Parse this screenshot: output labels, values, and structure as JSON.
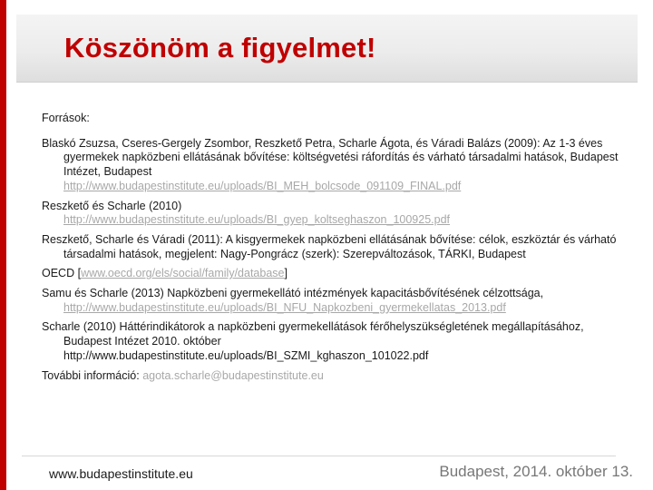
{
  "title": "Köszönöm a figyelmet!",
  "sources_heading": "Források:",
  "references": [
    {
      "text": "Blaskó Zsuzsa, Cseres-Gergely Zsombor, Reszkető Petra, Scharle Ágota, és Váradi Balázs (2009): Az 1-3 éves gyermekek napközbeni ellátásának bővítése: költségvetési ráfordítás és várható társadalmi hatások, Budapest Intézet, Budapest",
      "url": "http://www.budapestinstitute.eu/uploads/BI_MEH_bolcsode_091109_FINAL.pdf"
    },
    {
      "text": "Reszkető és Scharle (2010)",
      "url": "http://www.budapestinstitute.eu/uploads/BI_gyep_koltseghaszon_100925.pdf"
    },
    {
      "text": "Reszkető, Scharle és Váradi (2011): A kisgyermekek napközbeni ellátásának bővítése: célok, eszköztár és várható társadalmi hatások, megjelent: Nagy-Pongrácz (szerk): Szerepváltozások, TÁRKI, Budapest"
    }
  ],
  "oecd": {
    "prefix": "OECD [",
    "url": "www.oecd.org/els/social/family/database",
    "suffix": "]"
  },
  "references_2": [
    {
      "text": "Samu és Scharle (2013) Napközbeni gyermekellátó intézmények kapacitásbővítésének célzottsága,",
      "url": "http://www.budapestinstitute.eu/uploads/BI_NFU_Napkozbeni_gyermekellatas_2013.pdf"
    },
    {
      "text": "Scharle (2010) Háttérindikátorok a napközbeni gyermekellátások férőhelyszükségletének megállapításához, Budapest Intézet 2010. október",
      "url": "http://www.budapestinstitute.eu/uploads/BI_SZMI_kghaszon_101022.pdf"
    }
  ],
  "more_info": {
    "label": "További információ:",
    "email": "agota.scharle@budapestinstitute.eu"
  },
  "footer": {
    "website": "www.budapestinstitute.eu",
    "date": "Budapest, 2014. október 13."
  },
  "colors": {
    "accent": "#c00000",
    "link": "#a8a8a8"
  }
}
